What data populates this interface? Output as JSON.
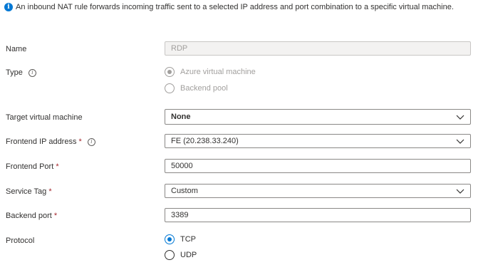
{
  "info": {
    "icon": "info-icon",
    "text": "An inbound NAT rule forwards incoming traffic sent to a selected IP address and port combination to a specific virtual machine."
  },
  "name": {
    "label": "Name",
    "value": "RDP"
  },
  "type": {
    "label": "Type",
    "options": [
      "Azure virtual machine",
      "Backend pool"
    ],
    "selected": "Azure virtual machine"
  },
  "target_vm": {
    "label": "Target virtual machine",
    "value": "None"
  },
  "frontend_ip": {
    "label": "Frontend IP address",
    "required": "*",
    "value": "FE (20.238.33.240)"
  },
  "frontend_port": {
    "label": "Frontend Port",
    "required": "*",
    "value": "50000"
  },
  "service_tag": {
    "label": "Service Tag",
    "required": "*",
    "value": "Custom"
  },
  "backend_port": {
    "label": "Backend port",
    "required": "*",
    "value": "3389"
  },
  "protocol": {
    "label": "Protocol",
    "options": [
      "TCP",
      "UDP"
    ],
    "selected": "TCP"
  },
  "colors": {
    "accent": "#0078d4",
    "required": "#a4262c"
  }
}
